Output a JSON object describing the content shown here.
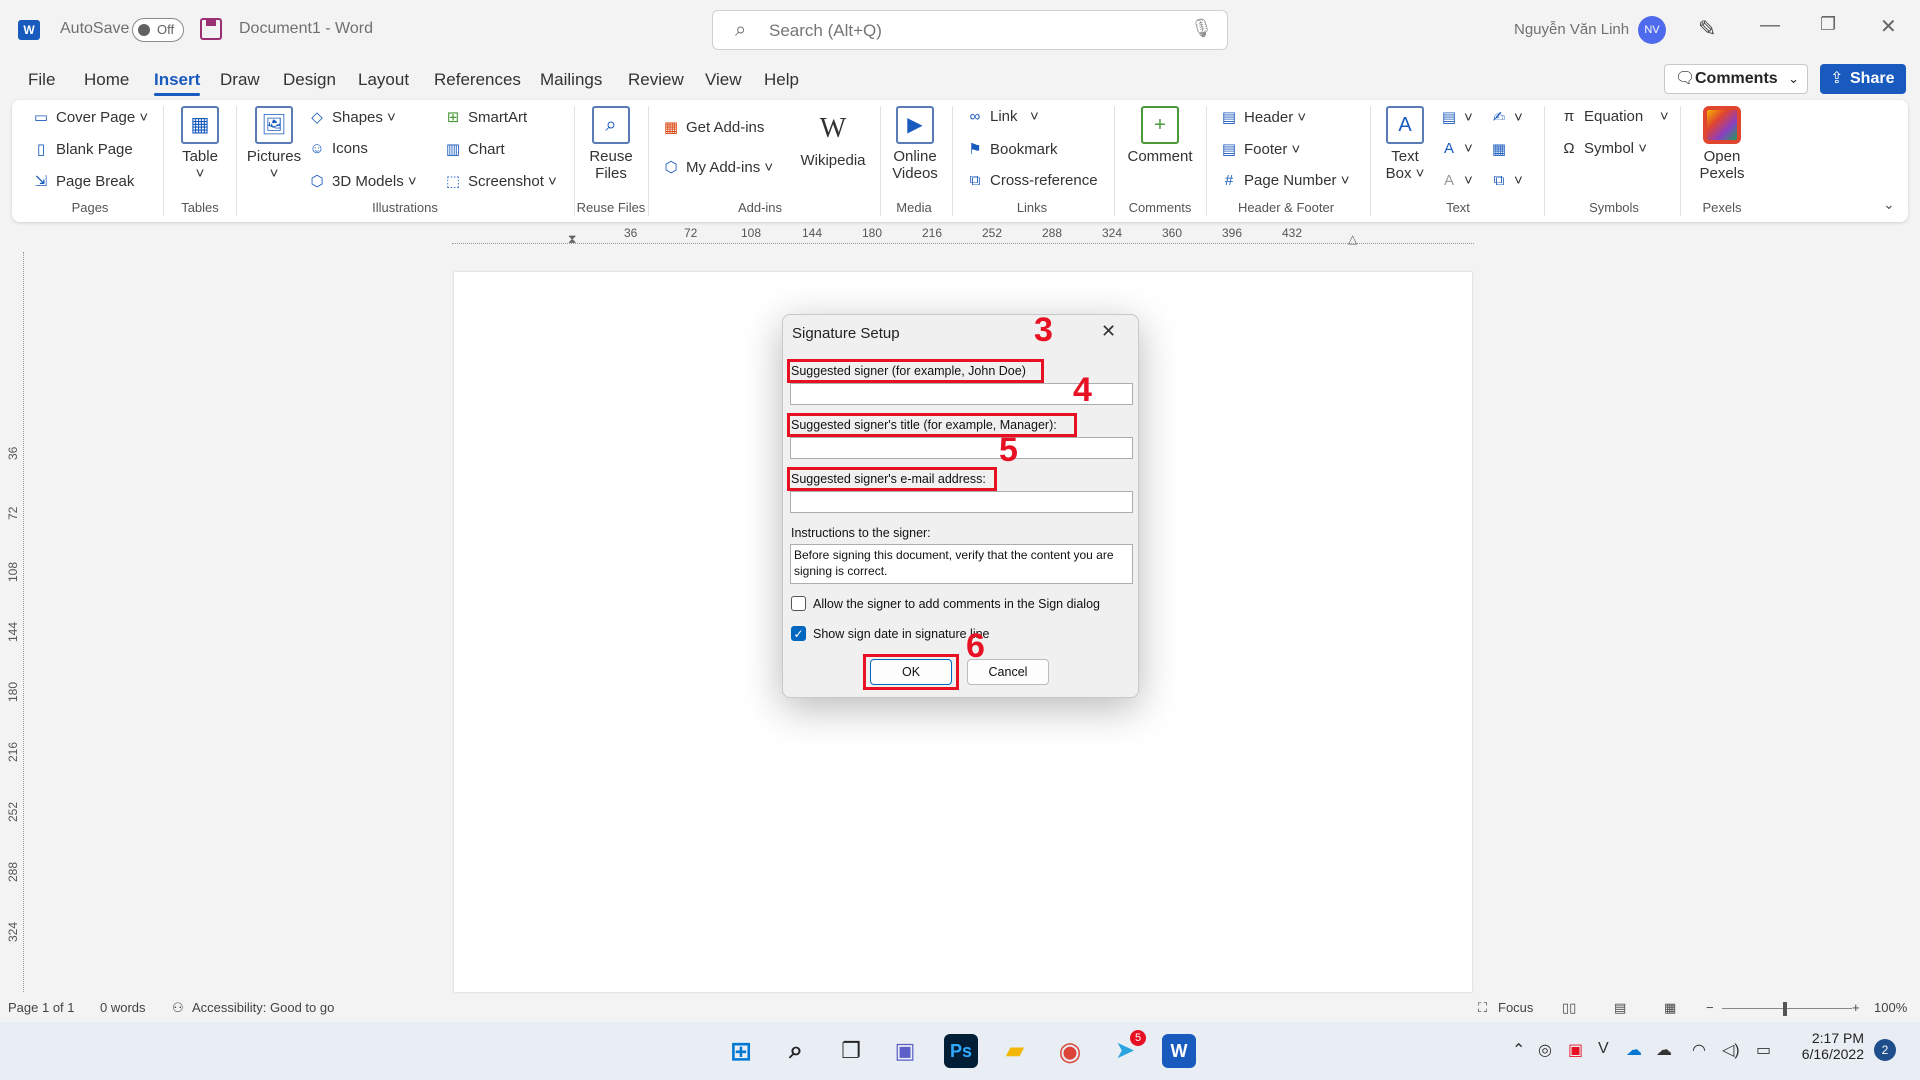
{
  "titlebar": {
    "app_logo": "W",
    "autosave_label": "AutoSave",
    "autosave_state": "Off",
    "doc_title": "Document1  -  Word",
    "search_placeholder": "Search (Alt+Q)",
    "user_name": "Nguyễn Văn Linh",
    "user_initials": "NV"
  },
  "menu": {
    "items": [
      "File",
      "Home",
      "Insert",
      "Draw",
      "Design",
      "Layout",
      "References",
      "Mailings",
      "Review",
      "View",
      "Help"
    ],
    "active": "Insert",
    "comments_label": "Comments",
    "share_label": "Share"
  },
  "ribbon": {
    "pages": {
      "cover_page": "Cover Page",
      "blank_page": "Blank Page",
      "page_break": "Page Break",
      "label": "Pages"
    },
    "tables": {
      "table": "Table",
      "label": "Tables"
    },
    "illustrations": {
      "pictures": "Pictures",
      "shapes": "Shapes",
      "icons": "Icons",
      "models": "3D Models",
      "smartart": "SmartArt",
      "chart": "Chart",
      "screenshot": "Screenshot",
      "label": "Illustrations"
    },
    "reuse": {
      "line1": "Reuse",
      "line2": "Files",
      "label": "Reuse Files"
    },
    "addins": {
      "get": "Get Add-ins",
      "my": "My Add-ins",
      "wikipedia": "Wikipedia",
      "label": "Add-ins"
    },
    "media": {
      "line1": "Online",
      "line2": "Videos",
      "label": "Media"
    },
    "links": {
      "link": "Link",
      "bookmark": "Bookmark",
      "cross": "Cross-reference",
      "label": "Links"
    },
    "comments": {
      "comment": "Comment",
      "label": "Comments"
    },
    "header_footer": {
      "header": "Header",
      "footer": "Footer",
      "page_number": "Page Number",
      "label": "Header & Footer"
    },
    "text": {
      "line1": "Text",
      "line2": "Box",
      "label": "Text"
    },
    "symbols": {
      "equation": "Equation",
      "symbol": "Symbol",
      "label": "Symbols"
    },
    "pexels": {
      "line1": "Open",
      "line2": "Pexels",
      "label": "Pexels"
    }
  },
  "ruler": {
    "h": [
      "36",
      "72",
      "108",
      "144",
      "180",
      "216",
      "252",
      "288",
      "324",
      "360",
      "396",
      "432"
    ],
    "v": [
      "36",
      "72",
      "108",
      "144",
      "180",
      "216",
      "252",
      "288",
      "324"
    ]
  },
  "dialog": {
    "title": "Signature Setup",
    "signer_label": "Suggested signer (for example, John Doe)",
    "title_label": "Suggested signer's title (for example, Manager):",
    "email_label": "Suggested signer's e-mail address:",
    "instructions_label": "Instructions to the signer:",
    "instructions_value": "Before signing this document, verify that the content you are signing is correct.",
    "allow_comments_label": "Allow the signer to add comments in the Sign dialog",
    "allow_comments_checked": false,
    "show_date_label": "Show sign date in signature line",
    "show_date_checked": true,
    "ok_label": "OK",
    "cancel_label": "Cancel"
  },
  "annotations": {
    "n3": "3",
    "n4": "4",
    "n5": "5",
    "n6": "6",
    "color": "#e81123"
  },
  "statusbar": {
    "page": "Page 1 of 1",
    "words": "0 words",
    "accessibility": "Accessibility: Good to go",
    "focus": "Focus",
    "zoom": "100%"
  },
  "taskbar": {
    "time": "2:17 PM",
    "date": "6/16/2022",
    "notifications": "2",
    "telegram_badge": "5",
    "photoshop_label": "Ps",
    "word_label": "W"
  }
}
